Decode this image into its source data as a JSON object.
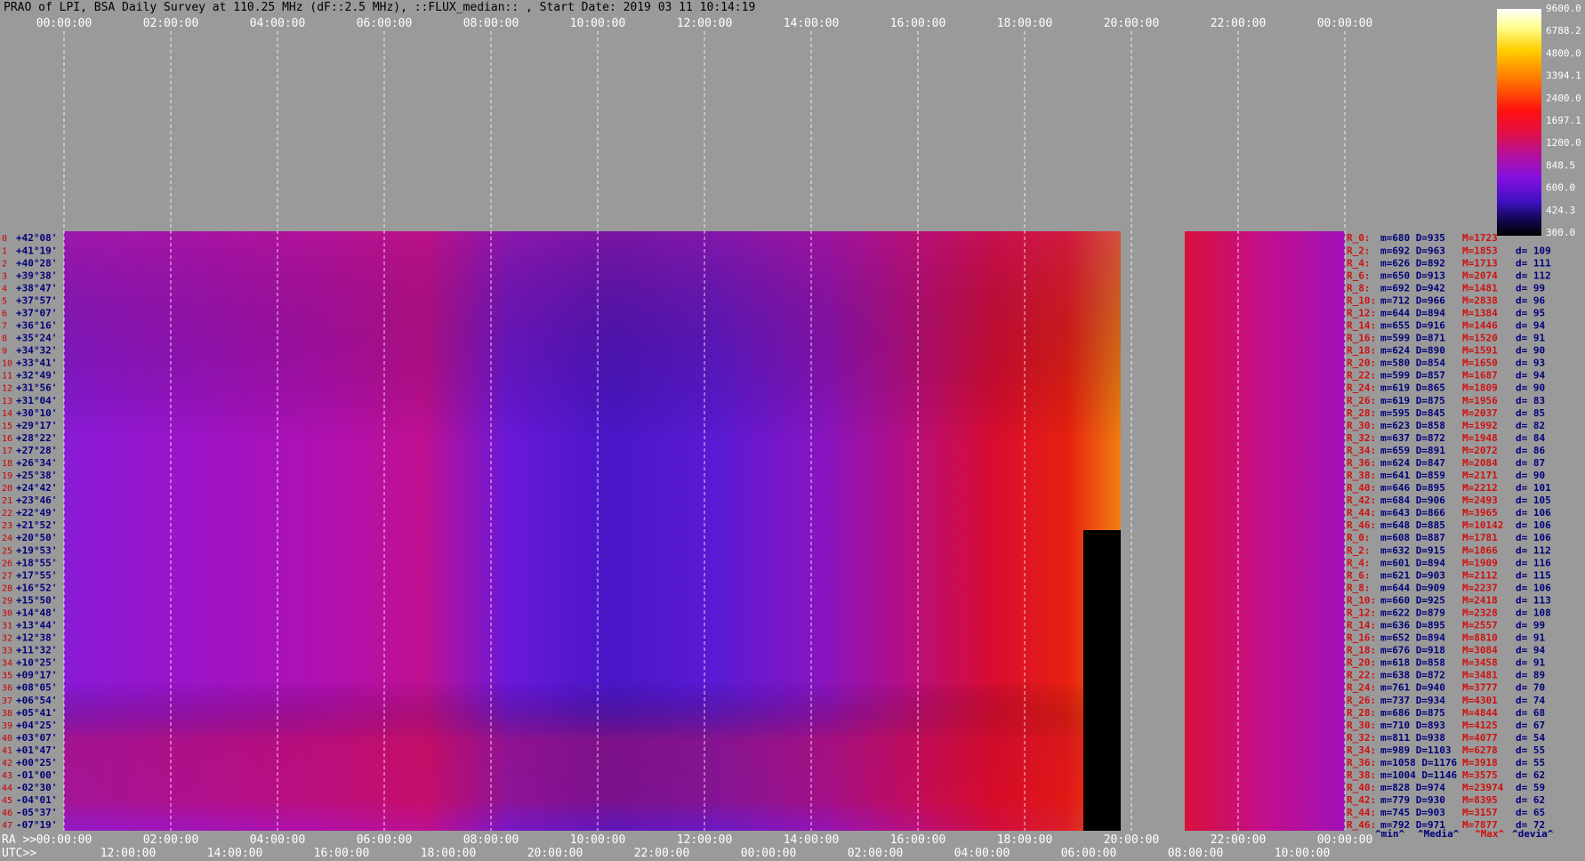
{
  "window": {
    "title": "PRAO of LPI, BSA Daily Survey at 110.25 MHz (dF::2.5 MHz), ::FLUX_median:: , Start Date: 2019 03 11 10:14:19"
  },
  "chart_data": {
    "type": "heatmap",
    "top_time_ticks": [
      "00:00:00",
      "02:00:00",
      "04:00:00",
      "06:00:00",
      "08:00:00",
      "10:00:00",
      "12:00:00",
      "14:00:00",
      "16:00:00",
      "18:00:00",
      "20:00:00",
      "22:00:00",
      "00:00:00"
    ],
    "ra_axis_label": "RA >>",
    "ra_ticks": [
      "00:00:00",
      "02:00:00",
      "04:00:00",
      "06:00:00",
      "08:00:00",
      "10:00:00",
      "12:00:00",
      "14:00:00",
      "16:00:00",
      "18:00:00",
      "20:00:00",
      "22:00:00",
      "00:00:00"
    ],
    "utc_axis_label": "UTC>>",
    "utc_ticks": [
      "12:00:00",
      "14:00:00",
      "16:00:00",
      "18:00:00",
      "20:00:00",
      "22:00:00",
      "00:00:00",
      "02:00:00",
      "04:00:00",
      "06:00:00",
      "08:00:00",
      "10:00:00"
    ],
    "declinations": [
      "+42°08'",
      "+41°19'",
      "+40°28'",
      "+39°38'",
      "+38°47'",
      "+37°57'",
      "+37°07'",
      "+36°16'",
      "+35°24'",
      "+34°32'",
      "+33°41'",
      "+32°49'",
      "+31°56'",
      "+31°04'",
      "+30°10'",
      "+29°17'",
      "+28°22'",
      "+27°28'",
      "+26°34'",
      "+25°38'",
      "+24°42'",
      "+23°46'",
      "+22°49'",
      "+21°52'",
      "+20°50'",
      "+19°53'",
      "+18°55'",
      "+17°55'",
      "+16°52'",
      "+15°50'",
      "+14°48'",
      "+13°44'",
      "+12°38'",
      "+11°32'",
      "+10°25'",
      "+09°17'",
      "+08°05'",
      "+06°54'",
      "+05°41'",
      "+04°25'",
      "+03°07'",
      "+01°47'",
      "+00°25'",
      "-01°00'",
      "-02°30'",
      "-04°01'",
      "-05°37'",
      "-07°19'"
    ],
    "colorbar_ticks": [
      "9600.0",
      "6788.2",
      "4800.0",
      "3394.1",
      "2400.0",
      "1697.1",
      "1200.0",
      "848.5",
      "600.0",
      "424.3",
      "300.0"
    ],
    "stats": [
      {
        "r": "R_0:",
        "m": 680,
        "D": 935,
        "M": 1723,
        "d": ""
      },
      {
        "r": "R_2:",
        "m": 692,
        "D": 963,
        "M": 1853,
        "d": 109
      },
      {
        "r": "R_4:",
        "m": 626,
        "D": 892,
        "M": 1713,
        "d": 111
      },
      {
        "r": "R_6:",
        "m": 650,
        "D": 913,
        "M": 2074,
        "d": 112
      },
      {
        "r": "R_8:",
        "m": 692,
        "D": 942,
        "M": 1481,
        "d": 99
      },
      {
        "r": "R_10:",
        "m": 712,
        "D": 966,
        "M": 2838,
        "d": 96
      },
      {
        "r": "R_12:",
        "m": 644,
        "D": 894,
        "M": 1384,
        "d": 95
      },
      {
        "r": "R_14:",
        "m": 655,
        "D": 916,
        "M": 1446,
        "d": 94
      },
      {
        "r": "R_16:",
        "m": 599,
        "D": 871,
        "M": 1520,
        "d": 91
      },
      {
        "r": "R_18:",
        "m": 624,
        "D": 890,
        "M": 1591,
        "d": 90
      },
      {
        "r": "R_20:",
        "m": 580,
        "D": 854,
        "M": 1650,
        "d": 93
      },
      {
        "r": "R_22:",
        "m": 599,
        "D": 857,
        "M": 1687,
        "d": 94
      },
      {
        "r": "R_24:",
        "m": 619,
        "D": 865,
        "M": 1809,
        "d": 90
      },
      {
        "r": "R_26:",
        "m": 619,
        "D": 875,
        "M": 1956,
        "d": 83
      },
      {
        "r": "R_28:",
        "m": 595,
        "D": 845,
        "M": 2037,
        "d": 85
      },
      {
        "r": "R_30:",
        "m": 623,
        "D": 858,
        "M": 1992,
        "d": 82
      },
      {
        "r": "R_32:",
        "m": 637,
        "D": 872,
        "M": 1948,
        "d": 84
      },
      {
        "r": "R_34:",
        "m": 659,
        "D": 891,
        "M": 2072,
        "d": 86
      },
      {
        "r": "R_36:",
        "m": 624,
        "D": 847,
        "M": 2084,
        "d": 87
      },
      {
        "r": "R_38:",
        "m": 641,
        "D": 859,
        "M": 2171,
        "d": 90
      },
      {
        "r": "R_40:",
        "m": 646,
        "D": 895,
        "M": 2212,
        "d": 101
      },
      {
        "r": "R_42:",
        "m": 684,
        "D": 906,
        "M": 2493,
        "d": 105
      },
      {
        "r": "R_44:",
        "m": 643,
        "D": 866,
        "M": 3965,
        "d": 106
      },
      {
        "r": "R_46:",
        "m": 648,
        "D": 885,
        "M": 10142,
        "d": 106
      },
      {
        "r": "R_0:",
        "m": 608,
        "D": 887,
        "M": 1781,
        "d": 106
      },
      {
        "r": "R_2:",
        "m": 632,
        "D": 915,
        "M": 1866,
        "d": 112
      },
      {
        "r": "R_4:",
        "m": 601,
        "D": 894,
        "M": 1909,
        "d": 116
      },
      {
        "r": "R_6:",
        "m": 621,
        "D": 903,
        "M": 2112,
        "d": 115
      },
      {
        "r": "R_8:",
        "m": 644,
        "D": 909,
        "M": 2237,
        "d": 106
      },
      {
        "r": "R_10:",
        "m": 660,
        "D": 925,
        "M": 2418,
        "d": 113
      },
      {
        "r": "R_12:",
        "m": 622,
        "D": 879,
        "M": 2328,
        "d": 108
      },
      {
        "r": "R_14:",
        "m": 636,
        "D": 895,
        "M": 2557,
        "d": 99
      },
      {
        "r": "R_16:",
        "m": 652,
        "D": 894,
        "M": 8810,
        "d": 91
      },
      {
        "r": "R_18:",
        "m": 676,
        "D": 918,
        "M": 3084,
        "d": 94
      },
      {
        "r": "R_20:",
        "m": 618,
        "D": 858,
        "M": 3458,
        "d": 91
      },
      {
        "r": "R_22:",
        "m": 638,
        "D": 872,
        "M": 3481,
        "d": 89
      },
      {
        "r": "R_24:",
        "m": 761,
        "D": 940,
        "M": 3777,
        "d": 70
      },
      {
        "r": "R_26:",
        "m": 737,
        "D": 934,
        "M": 4301,
        "d": 74
      },
      {
        "r": "R_28:",
        "m": 686,
        "D": 875,
        "M": 4844,
        "d": 68
      },
      {
        "r": "R_30:",
        "m": 710,
        "D": 893,
        "M": 4125,
        "d": 67
      },
      {
        "r": "R_32:",
        "m": 811,
        "D": 938,
        "M": 4077,
        "d": 54
      },
      {
        "r": "R_34:",
        "m": 989,
        "D": 1103,
        "M": 6278,
        "d": 55
      },
      {
        "r": "R_36:",
        "m": 1058,
        "D": 1176,
        "M": 3918,
        "d": 55
      },
      {
        "r": "R_38:",
        "m": 1004,
        "D": 1146,
        "M": 3575,
        "d": 62
      },
      {
        "r": "R_40:",
        "m": 828,
        "D": 974,
        "M": 23974,
        "d": 59
      },
      {
        "r": "R_42:",
        "m": 779,
        "D": 930,
        "M": 8395,
        "d": 62
      },
      {
        "r": "R_44:",
        "m": 745,
        "D": 903,
        "M": 3157,
        "d": 65
      },
      {
        "r": "R_46:",
        "m": 792,
        "D": 971,
        "M": 7877,
        "d": 72
      }
    ],
    "stats_legend": [
      "^min^",
      "^Media^",
      "^Max^",
      "^devia^"
    ],
    "colors": {
      "background": "#9a9a9a",
      "stat_red": "#d01010",
      "stat_blue": "#00007a",
      "dec_red": "#cc0000"
    }
  }
}
